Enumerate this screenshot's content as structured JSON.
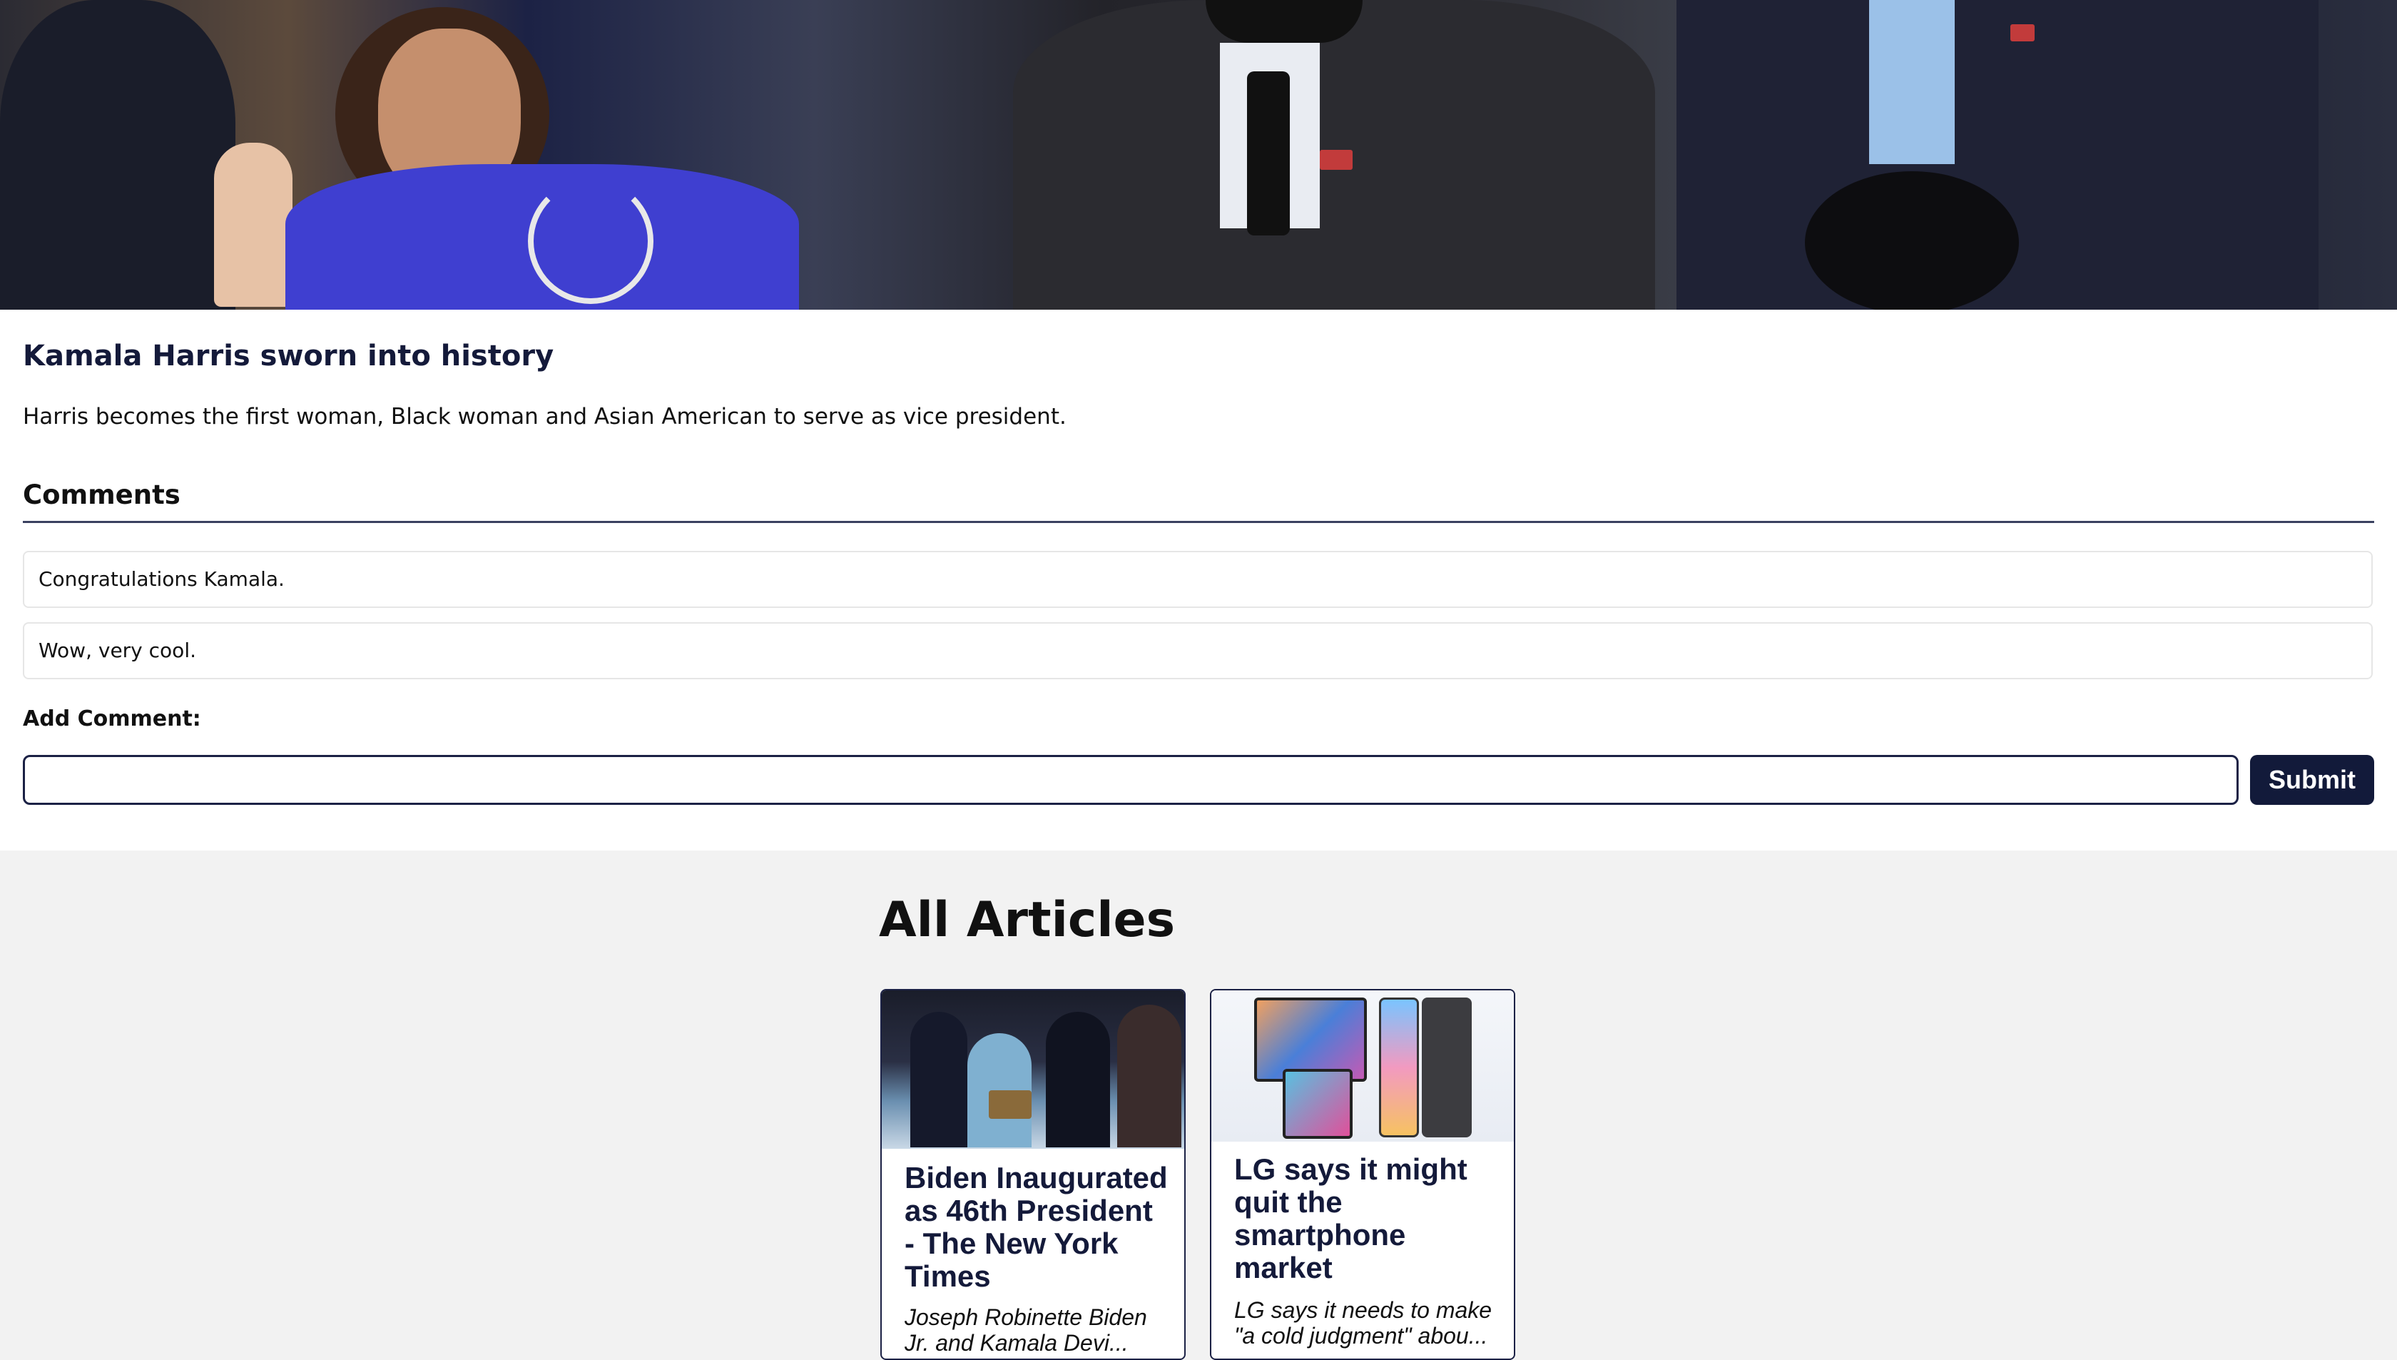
{
  "article": {
    "title": "Kamala Harris sworn into history",
    "description": "Harris becomes the first woman, Black woman and Asian American to serve as vice president."
  },
  "comments": {
    "heading": "Comments",
    "items": [
      "Congratulations Kamala.",
      "Wow, very cool."
    ],
    "add_label": "Add Comment:",
    "input_value": "",
    "submit_label": "Submit"
  },
  "all_articles": {
    "heading": "All Articles",
    "cards": [
      {
        "title": "Biden Inaugurated as 46th President - The New York Times",
        "description": "Joseph Robinette Biden Jr. and Kamala Devi..."
      },
      {
        "title": "LG says it might quit the smartphone market",
        "description": "LG says it needs to make \"a cold judgment\" abou..."
      }
    ]
  },
  "colors": {
    "navy": "#121a3a",
    "panel_bg": "#ffffff",
    "page_bg": "#f2f2f2"
  }
}
